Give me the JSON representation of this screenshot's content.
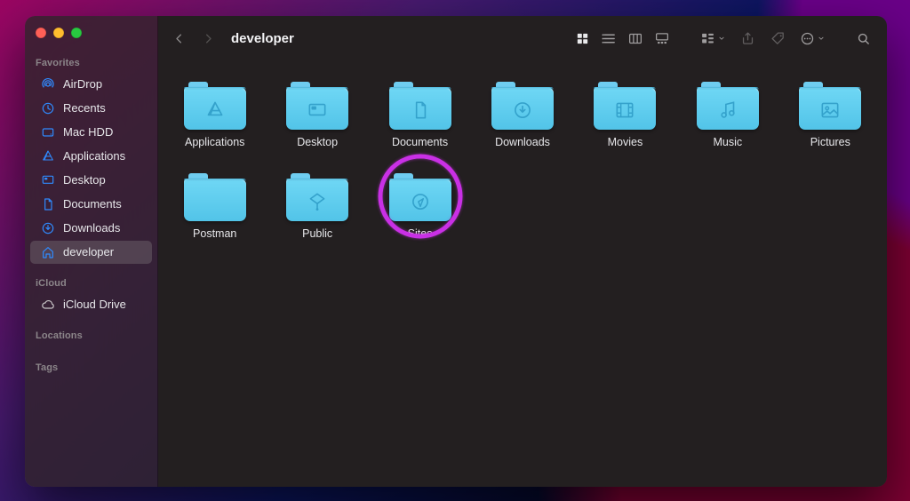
{
  "window": {
    "title": "developer"
  },
  "sidebar": {
    "sections": [
      {
        "label": "Favorites",
        "items": [
          {
            "icon": "airdrop",
            "label": "AirDrop"
          },
          {
            "icon": "recents",
            "label": "Recents"
          },
          {
            "icon": "disk",
            "label": "Mac HDD"
          },
          {
            "icon": "apps",
            "label": "Applications"
          },
          {
            "icon": "desktop",
            "label": "Desktop"
          },
          {
            "icon": "documents",
            "label": "Documents"
          },
          {
            "icon": "downloads",
            "label": "Downloads"
          },
          {
            "icon": "home",
            "label": "developer",
            "active": true
          }
        ]
      },
      {
        "label": "iCloud",
        "items": [
          {
            "icon": "cloud",
            "label": "iCloud Drive"
          }
        ]
      },
      {
        "label": "Locations",
        "items": []
      },
      {
        "label": "Tags",
        "items": []
      }
    ]
  },
  "folders": [
    {
      "label": "Applications",
      "glyph": "apps"
    },
    {
      "label": "Desktop",
      "glyph": "desktop"
    },
    {
      "label": "Documents",
      "glyph": "documents"
    },
    {
      "label": "Downloads",
      "glyph": "downloads"
    },
    {
      "label": "Movies",
      "glyph": "movies"
    },
    {
      "label": "Music",
      "glyph": "music"
    },
    {
      "label": "Pictures",
      "glyph": "pictures"
    },
    {
      "label": "Postman",
      "glyph": ""
    },
    {
      "label": "Public",
      "glyph": "public"
    },
    {
      "label": "Sites",
      "glyph": "sites",
      "highlight": true
    }
  ],
  "colors": {
    "accent": "#2f8bff",
    "folder": "#5ecbef",
    "highlight_ring": "#c930e5"
  }
}
